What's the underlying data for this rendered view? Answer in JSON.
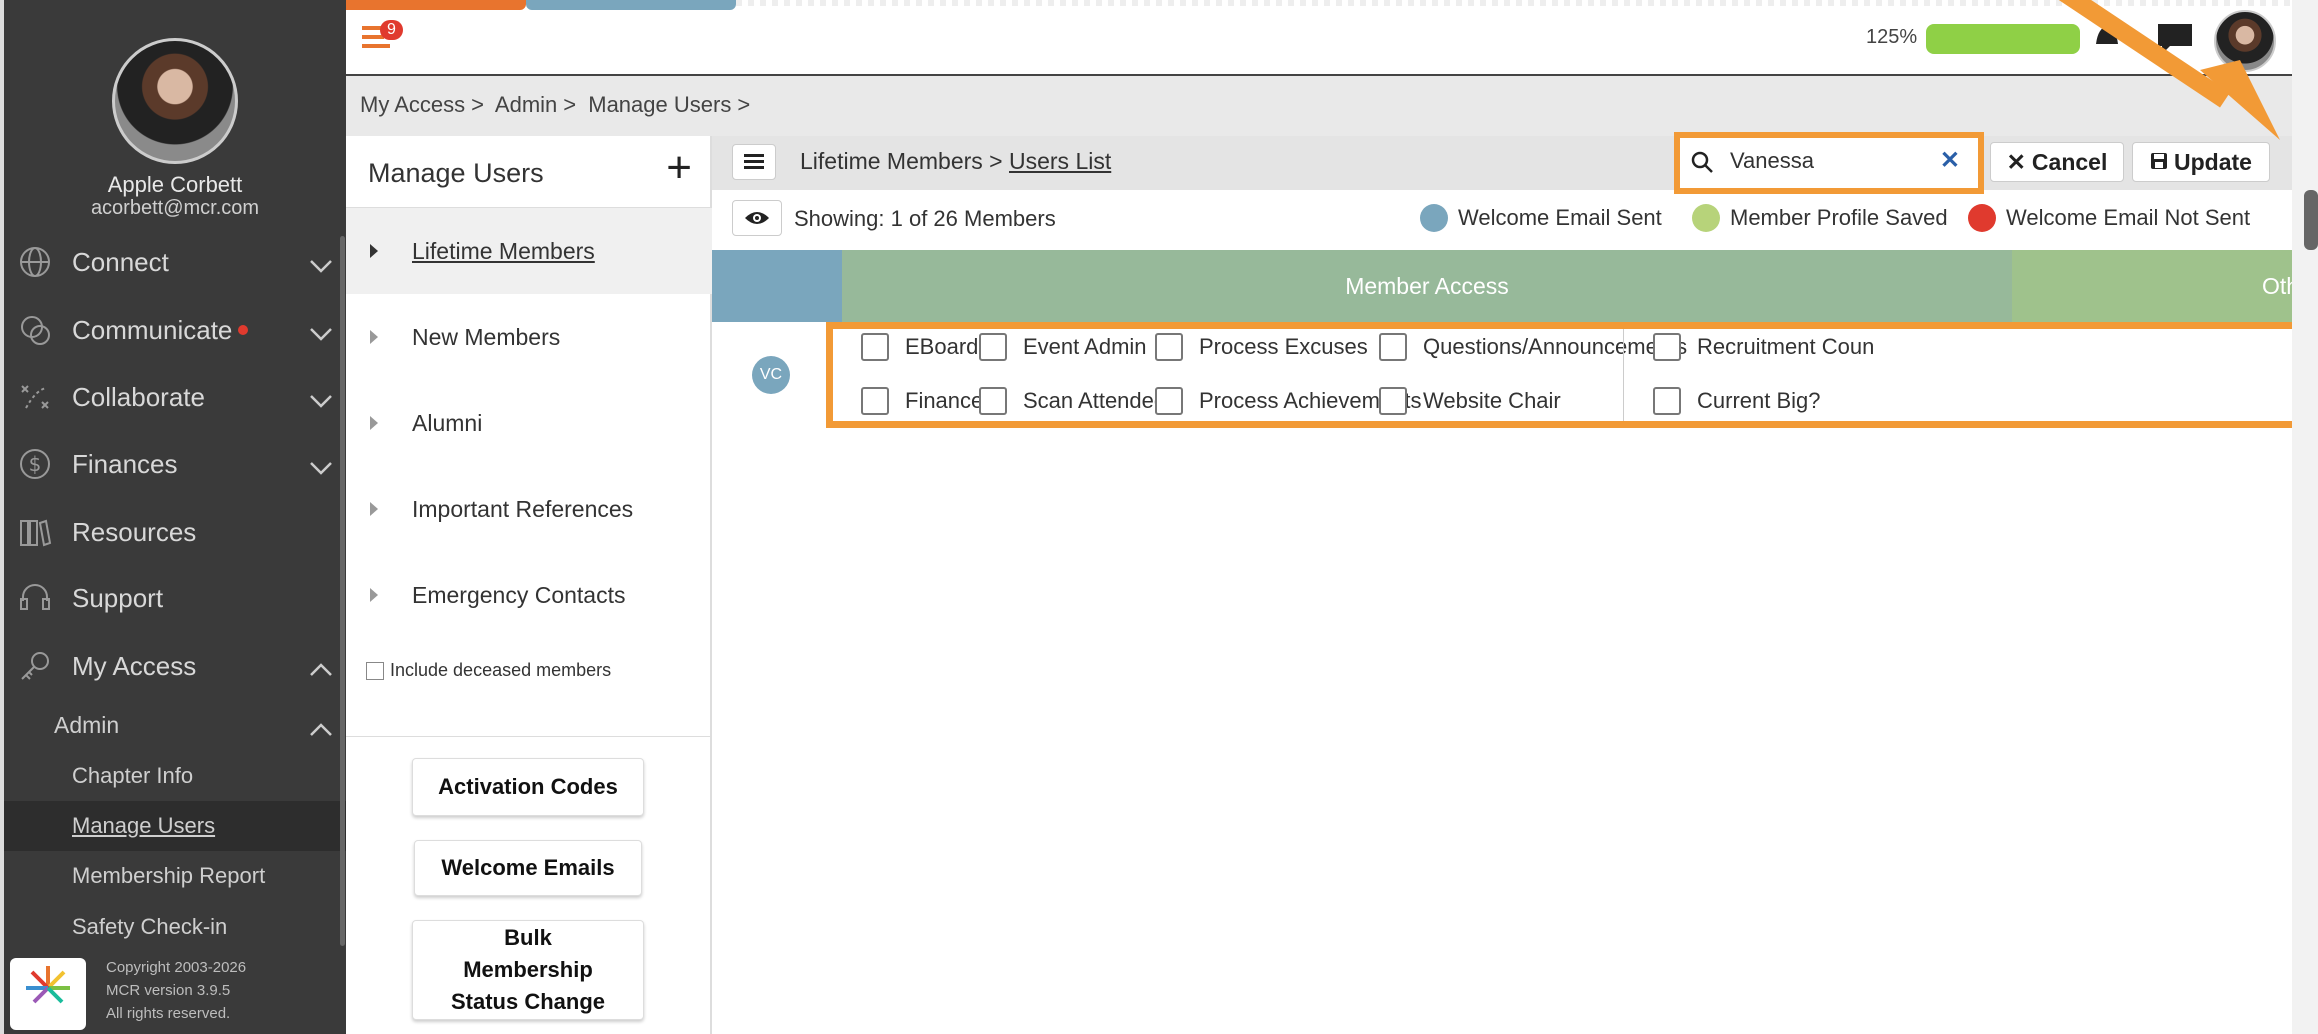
{
  "profile": {
    "name": "Apple Corbett",
    "email": "acorbett@mcr.com"
  },
  "nav": [
    {
      "label": "Connect",
      "icon": "globe-icon",
      "chevron": "down"
    },
    {
      "label": "Communicate",
      "icon": "chat-bubbles-icon",
      "chevron": "down",
      "dot": true
    },
    {
      "label": "Collaborate",
      "icon": "strategy-icon",
      "chevron": "down"
    },
    {
      "label": "Finances",
      "icon": "dollar-icon",
      "chevron": "down"
    },
    {
      "label": "Resources",
      "icon": "books-icon"
    },
    {
      "label": "Support",
      "icon": "headset-icon"
    },
    {
      "label": "My Access",
      "icon": "key-icon",
      "chevron": "up"
    }
  ],
  "admin": {
    "label": "Admin"
  },
  "admin_items": [
    "Chapter Info",
    "Manage Users",
    "Membership Report",
    "Safety Check-in"
  ],
  "footer": {
    "line1": "Copyright 2003-2026",
    "line2": "MCR version 3.9.5",
    "line3": "All rights reserved."
  },
  "topbar": {
    "badge": "9",
    "zoom": "125%",
    "accent": "#8fd046"
  },
  "breadcrumb": [
    "My Access",
    "Admin",
    "Manage Users"
  ],
  "left_panel": {
    "title": "Manage Users",
    "items": [
      "Lifetime Members",
      "New Members",
      "Alumni",
      "Important References",
      "Emergency Contacts"
    ],
    "deceased": "Include deceased members",
    "buttons": {
      "activation": "Activation Codes",
      "welcome": "Welcome Emails",
      "bulk1": "Bulk",
      "bulk2": "Membership",
      "bulk3": "Status Change"
    }
  },
  "main": {
    "crumb_parent": "Lifetime Members",
    "crumb_sep": ">",
    "crumb_current": "Users List",
    "search_value": "Vanessa",
    "cancel": "Cancel",
    "update": "Update",
    "showing": "Showing: 1 of 26 Members",
    "legend": [
      {
        "label": "Welcome Email Sent",
        "color": "#7aa6bd"
      },
      {
        "label": "Member Profile Saved",
        "color": "#b7d37a"
      },
      {
        "label": "Welcome Email Not Sent",
        "color": "#e03a2e"
      }
    ],
    "col_access": "Member Access",
    "col_other": "Othe",
    "member_initials": "VC",
    "permissions": [
      [
        "EBoard?",
        "Event Admin",
        "Process Excuses",
        "Questions/Announcements",
        "Recruitment Coun"
      ],
      [
        "Finance",
        "Scan Attendees",
        "Process Achievements",
        "Website Chair",
        "Current Big?"
      ]
    ]
  },
  "colors": {
    "sidebar": "#3a3a3a",
    "highlight": "#f29a36",
    "access_header": "#97b99a",
    "id_header": "#7aa6bd"
  }
}
